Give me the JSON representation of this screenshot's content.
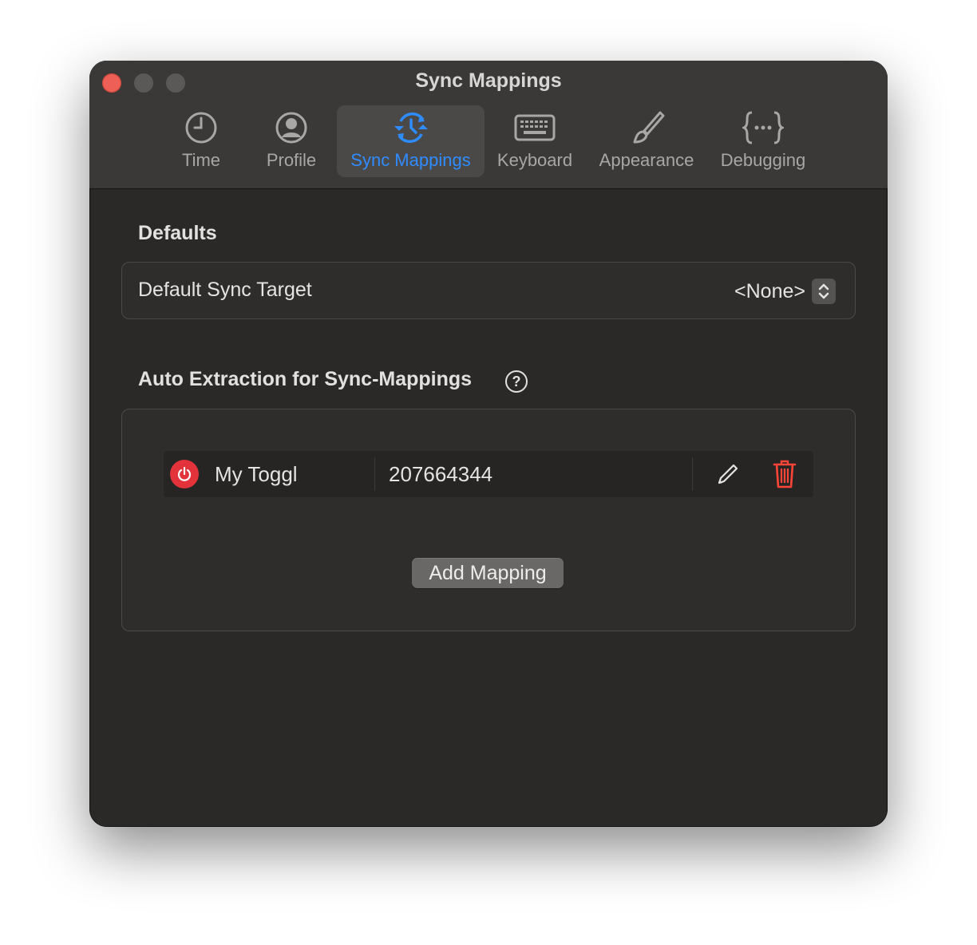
{
  "window": {
    "title": "Sync Mappings"
  },
  "tabs": [
    {
      "label": "Time",
      "icon": "clock-icon",
      "active": false
    },
    {
      "label": "Profile",
      "icon": "person-circle-icon",
      "active": false
    },
    {
      "label": "Sync Mappings",
      "icon": "sync-clock-icon",
      "active": true
    },
    {
      "label": "Keyboard",
      "icon": "keyboard-icon",
      "active": false
    },
    {
      "label": "Appearance",
      "icon": "paintbrush-icon",
      "active": false
    },
    {
      "label": "Debugging",
      "icon": "curly-braces-icon",
      "active": false
    }
  ],
  "defaults": {
    "title": "Defaults",
    "sync_target_label": "Default Sync Target",
    "sync_target_value": "<None>"
  },
  "auto_extraction": {
    "title": "Auto Extraction for Sync-Mappings",
    "help_glyph": "?",
    "mappings": [
      {
        "name": "My Toggl",
        "id": "207664344",
        "enabled_icon": "power-icon",
        "enabled_color": "#e2333b"
      }
    ],
    "add_button": "Add Mapping"
  },
  "colors": {
    "accent": "#2f8cff",
    "delete": "#ff4537",
    "window_bg": "#2b2928"
  }
}
